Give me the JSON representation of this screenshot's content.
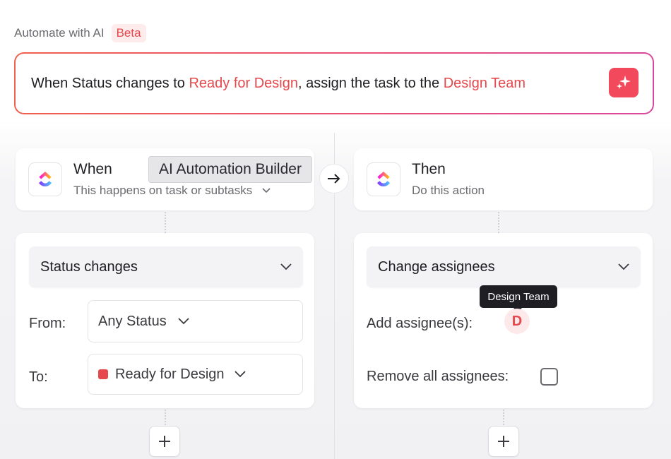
{
  "header": {
    "title": "Automate with AI",
    "badge": "Beta"
  },
  "prompt": {
    "part1": "When Status changes to ",
    "highlight1": "Ready for Design",
    "part2": ", assign the task to the ",
    "highlight2": "Design Team",
    "action_icon": "sparkles-icon"
  },
  "tooltips": {
    "builder": "AI Automation Builder",
    "assignee": "Design Team"
  },
  "when": {
    "title": "When",
    "subtitle": "This happens on task or subtasks",
    "trigger": "Status changes",
    "from_label": "From:",
    "from_value": "Any Status",
    "to_label": "To:",
    "to_value": "Ready for Design"
  },
  "then": {
    "title": "Then",
    "subtitle": "Do this action",
    "action": "Change assignees",
    "add_label": "Add assignee(s):",
    "assignee_initial": "D",
    "remove_label": "Remove all assignees:"
  },
  "colors": {
    "accent": "#e5484d",
    "gradient_start": "#f0604d",
    "gradient_end": "#d9489c"
  }
}
